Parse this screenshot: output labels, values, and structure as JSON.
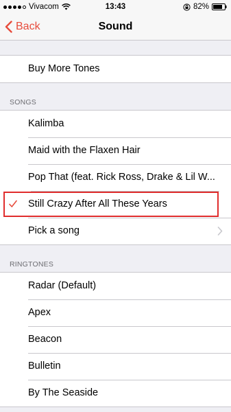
{
  "status_bar": {
    "carrier": "Vivacom",
    "time": "13:43",
    "battery": "82%"
  },
  "nav": {
    "back_label": "Back",
    "title": "Sound"
  },
  "store": {
    "buy_label": "Buy More Tones"
  },
  "songs": {
    "header": "SONGS",
    "items": [
      "Kalimba",
      "Maid with the Flaxen Hair",
      "Pop That (feat. Rick Ross, Drake & Lil W...",
      "Still Crazy After All These Years"
    ],
    "selected_index": 3,
    "pick_label": "Pick a song"
  },
  "ringtones": {
    "header": "RINGTONES",
    "items": [
      "Radar (Default)",
      "Apex",
      "Beacon",
      "Bulletin",
      "By The Seaside"
    ]
  },
  "colors": {
    "accent": "#e74c3c",
    "highlight_border": "#e02c2c",
    "background": "#efeff4"
  }
}
